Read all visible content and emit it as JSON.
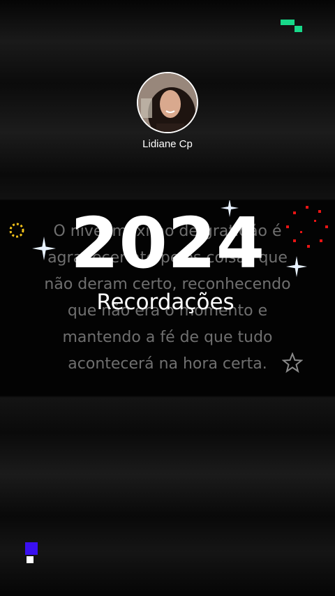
{
  "profile": {
    "username": "Lidiane Cp"
  },
  "video": {
    "quote_lines": [
      "O nível máximo de gratidão é",
      "agradecer até pelos coisas que",
      "não deram certo, reconhecendo",
      "que não era o momento e",
      "mantendo a fé de que tudo",
      "acontecerá na hora certa."
    ],
    "year": "2024",
    "subtitle": "Recordações"
  },
  "colors": {
    "top_pixel_icon": "#18d98a",
    "bottom_pixel_icon": "#3a10f0",
    "sparkle": "#e8f2ff",
    "fireworks_red": "#e81414",
    "fireworks_yellow": "#f2c21a"
  }
}
